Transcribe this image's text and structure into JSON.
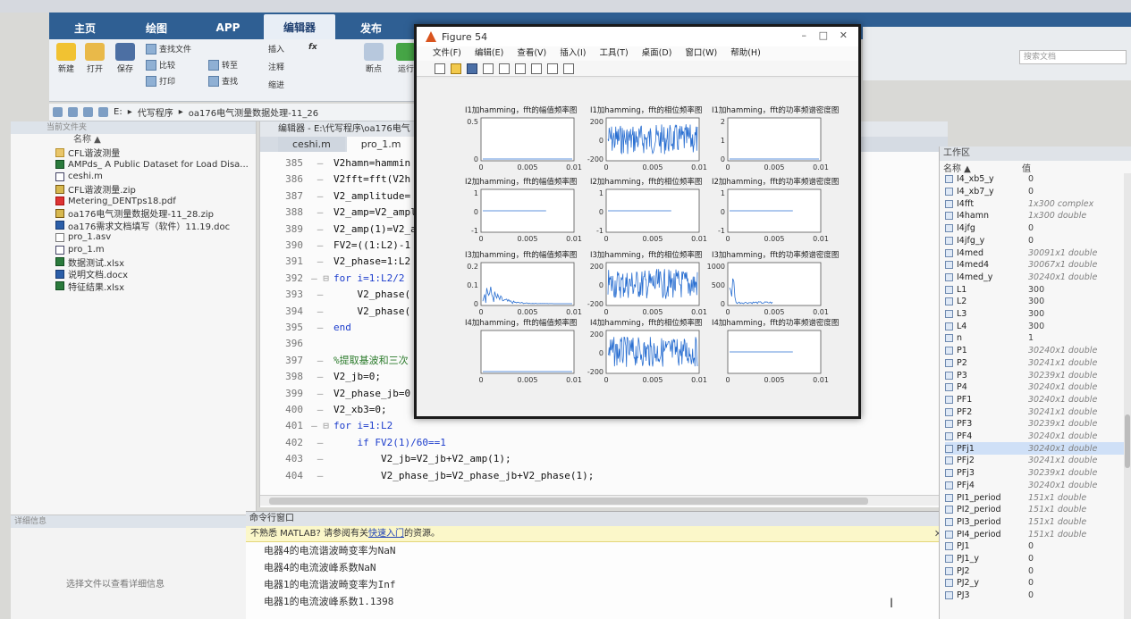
{
  "ribbon": {
    "tabs": [
      "主页",
      "绘图",
      "APP",
      "编辑器",
      "发布"
    ],
    "buttons": {
      "new": "新建",
      "open": "打开",
      "save": "保存",
      "find_files": "查找文件",
      "compare": "比较",
      "print": "打印",
      "goto": "转至",
      "find": "查找",
      "insert": "插入",
      "fx": "fx",
      "comment": "注释",
      "indent": "缩进",
      "breakpoint": "断点",
      "run": "运行"
    },
    "search_placeholder": "搜索文档"
  },
  "address": {
    "parts": [
      "E:",
      "代写程序",
      "oa176电气测量数据处理-11_26"
    ]
  },
  "file_panel": {
    "title": "当前文件夹",
    "col_name": "名称 ▲",
    "items": [
      {
        "name": "CFL谐波测量",
        "icon": "fold"
      },
      {
        "name": "AMPds_ A Public Dataset for Load Disa...",
        "icon": "xls"
      },
      {
        "name": "ceshi.m",
        "icon": "m"
      },
      {
        "name": "CFL谐波测量.zip",
        "icon": "zip"
      },
      {
        "name": "Metering_DENTps18.pdf",
        "icon": "pdf"
      },
      {
        "name": "oa176电气测量数据处理-11_28.zip",
        "icon": "zip"
      },
      {
        "name": "oa176需求文档填写（软件）11.19.doc",
        "icon": "doc"
      },
      {
        "name": "pro_1.asv",
        "icon": "plain"
      },
      {
        "name": "pro_1.m",
        "icon": "m"
      },
      {
        "name": "数据测试.xlsx",
        "icon": "xls"
      },
      {
        "name": "说明文档.docx",
        "icon": "doc"
      },
      {
        "name": "特征结果.xlsx",
        "icon": "xls"
      }
    ]
  },
  "details": {
    "title": "详细信息",
    "message": "选择文件以查看详细信息"
  },
  "editor": {
    "title": "编辑器 - E:\\代写程序\\oa176电气",
    "tabs": [
      "ceshi.m",
      "pro_1.m"
    ],
    "lines": [
      {
        "no": "385",
        "code": "V2hamn=hammin"
      },
      {
        "no": "386",
        "code": "V2fft=fft(V2h"
      },
      {
        "no": "387",
        "code": "V2_amplitude="
      },
      {
        "no": "388",
        "code": "V2_amp=V2_ampl"
      },
      {
        "no": "389",
        "code": "V2_amp(1)=V2_a"
      },
      {
        "no": "390",
        "code": "FV2=((1:L2)-1"
      },
      {
        "no": "391",
        "code": "V2_phase=1:L2"
      },
      {
        "no": "392",
        "code": "for i=1:L2/2"
      },
      {
        "no": "393",
        "code": "    V2_phase("
      },
      {
        "no": "394",
        "code": "    V2_phase("
      },
      {
        "no": "395",
        "code": "end"
      },
      {
        "no": "396",
        "code": ""
      },
      {
        "no": "397",
        "code": "%提取基波和三次"
      },
      {
        "no": "398",
        "code": "V2_jb=0;"
      },
      {
        "no": "399",
        "code": "V2_phase_jb=0"
      },
      {
        "no": "400",
        "code": "V2_xb3=0;"
      },
      {
        "no": "401",
        "code": "for i=1:L2"
      },
      {
        "no": "402",
        "code": "    if FV2(1)/60==1"
      },
      {
        "no": "403",
        "code": "        V2_jb=V2_jb+V2_amp(1);"
      },
      {
        "no": "404",
        "code": "        V2_phase_jb=V2_phase_jb+V2_phase(1);"
      }
    ]
  },
  "command": {
    "title": "命令行窗口",
    "banner_prefix": "不熟悉 MATLAB? 请参阅有关",
    "banner_link": "快速入门",
    "banner_suffix": "的资源。",
    "lines": [
      "电器4的电流谐波畸变率为NaN",
      "电器4的电流波峰系数NaN",
      "电器1的电流谐波畸变率为Inf",
      "电器1的电流波峰系数1.1398"
    ]
  },
  "workspace": {
    "title": "工作区",
    "col_name": "名称 ▲",
    "col_value": "值",
    "rows": [
      {
        "name": "I4_xb5_y",
        "value": "0",
        "ital": false
      },
      {
        "name": "I4_xb7_y",
        "value": "0",
        "ital": false
      },
      {
        "name": "I4fft",
        "value": "1x300 complex",
        "ital": true
      },
      {
        "name": "I4hamn",
        "value": "1x300 double",
        "ital": true
      },
      {
        "name": "I4jfg",
        "value": "0",
        "ital": false
      },
      {
        "name": "I4jfg_y",
        "value": "0",
        "ital": false
      },
      {
        "name": "I4med",
        "value": "30091x1 double",
        "ital": true
      },
      {
        "name": "I4med4",
        "value": "30067x1 double",
        "ital": true
      },
      {
        "name": "I4med_y",
        "value": "30240x1 double",
        "ital": true
      },
      {
        "name": "L1",
        "value": "300",
        "ital": false
      },
      {
        "name": "L2",
        "value": "300",
        "ital": false
      },
      {
        "name": "L3",
        "value": "300",
        "ital": false
      },
      {
        "name": "L4",
        "value": "300",
        "ital": false
      },
      {
        "name": "n",
        "value": "1",
        "ital": false
      },
      {
        "name": "P1",
        "value": "30240x1 double",
        "ital": true
      },
      {
        "name": "P2",
        "value": "30241x1 double",
        "ital": true
      },
      {
        "name": "P3",
        "value": "30239x1 double",
        "ital": true
      },
      {
        "name": "P4",
        "value": "30240x1 double",
        "ital": true
      },
      {
        "name": "PF1",
        "value": "30240x1 double",
        "ital": true
      },
      {
        "name": "PF2",
        "value": "30241x1 double",
        "ital": true
      },
      {
        "name": "PF3",
        "value": "30239x1 double",
        "ital": true
      },
      {
        "name": "PF4",
        "value": "30240x1 double",
        "ital": true
      },
      {
        "name": "PFj1",
        "value": "30240x1 double",
        "ital": true
      },
      {
        "name": "PFj2",
        "value": "30241x1 double",
        "ital": true
      },
      {
        "name": "PFj3",
        "value": "30239x1 double",
        "ital": true
      },
      {
        "name": "PFj4",
        "value": "30240x1 double",
        "ital": true
      },
      {
        "name": "PI1_period",
        "value": "151x1 double",
        "ital": true
      },
      {
        "name": "PI2_period",
        "value": "151x1 double",
        "ital": true
      },
      {
        "name": "PI3_period",
        "value": "151x1 double",
        "ital": true
      },
      {
        "name": "PI4_period",
        "value": "151x1 double",
        "ital": true
      },
      {
        "name": "PJ1",
        "value": "0",
        "ital": false
      },
      {
        "name": "PJ1_y",
        "value": "0",
        "ital": false
      },
      {
        "name": "PJ2",
        "value": "0",
        "ital": false
      },
      {
        "name": "PJ2_y",
        "value": "0",
        "ital": false
      },
      {
        "name": "PJ3",
        "value": "0",
        "ital": false
      }
    ]
  },
  "figure": {
    "title": "Figure 54",
    "menus": [
      "文件(F)",
      "编辑(E)",
      "查看(V)",
      "插入(I)",
      "工具(T)",
      "桌面(D)",
      "窗口(W)",
      "帮助(H)"
    ],
    "rows": [
      {
        "titles": [
          "I1加hamming，fft的幅值频率图",
          "I1加hamming，fft的相位频率图",
          "I1加hamming，fft的功率频谱密度图"
        ],
        "yticks": [
          [
            "0.5",
            "0"
          ],
          [
            "200",
            "0",
            "-200"
          ],
          [
            "2",
            "1",
            "0"
          ]
        ],
        "kinds": [
          "flat",
          "noise",
          "flat"
        ]
      },
      {
        "titles": [
          "I2加hamming，fft的幅值频率图",
          "I2加hamming，fft的相位频率图",
          "I2加hamming，fft的功率频谱密度图"
        ],
        "yticks": [
          [
            "1",
            "0",
            "-1"
          ],
          [
            "1",
            "0",
            "-1"
          ],
          [
            "1",
            "0",
            "-1"
          ]
        ],
        "kinds": [
          "midline",
          "midline",
          "midline"
        ]
      },
      {
        "titles": [
          "I3加hamming，fft的幅值频率图",
          "I3加hamming，fft的相位频率图",
          "I3加hamming，fft的功率频谱密度图"
        ],
        "yticks": [
          [
            "0.2",
            "0.1",
            "0"
          ],
          [
            "200",
            "0",
            "-200"
          ],
          [
            "1000",
            "500",
            "0"
          ]
        ],
        "kinds": [
          "decay",
          "noise",
          "spike"
        ]
      },
      {
        "titles": [
          "I4加hamming，fft的幅值频率图",
          "I4加hamming，fft的相位频率图",
          "I4加hamming，fft的功率频谱密度图"
        ],
        "yticks": [
          [
            "",
            ""
          ],
          [
            "200",
            "0",
            "-200"
          ],
          [
            "",
            ""
          ]
        ],
        "kinds": [
          "flat",
          "noise",
          "midline"
        ]
      }
    ],
    "xticks": [
      "0",
      "0.005",
      "0.01"
    ]
  }
}
